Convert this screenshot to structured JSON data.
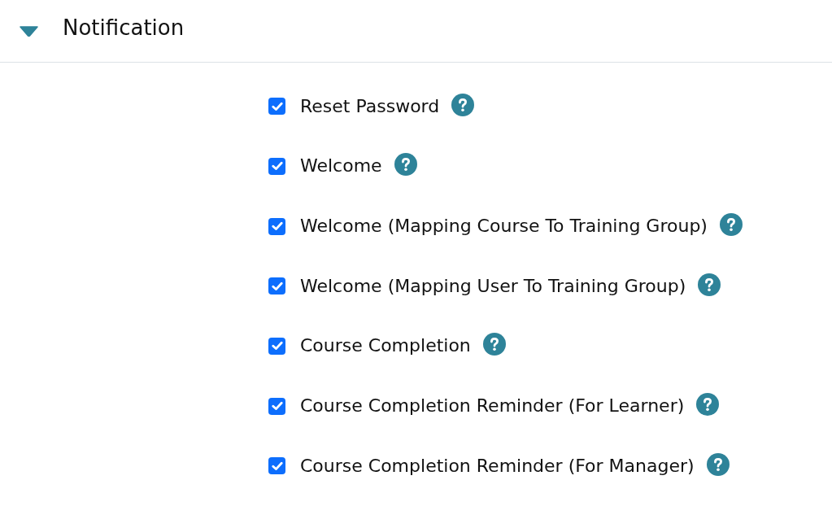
{
  "section": {
    "title": "Notification",
    "expanded": true
  },
  "items": [
    {
      "label": "Reset Password",
      "checked": true
    },
    {
      "label": "Welcome",
      "checked": true
    },
    {
      "label": "Welcome (Mapping Course To Training Group)",
      "checked": true
    },
    {
      "label": "Welcome (Mapping User To Training Group)",
      "checked": true
    },
    {
      "label": "Course Completion",
      "checked": true
    },
    {
      "label": "Course Completion Reminder (For Learner)",
      "checked": true
    },
    {
      "label": "Course Completion Reminder (For Manager)",
      "checked": true
    }
  ]
}
